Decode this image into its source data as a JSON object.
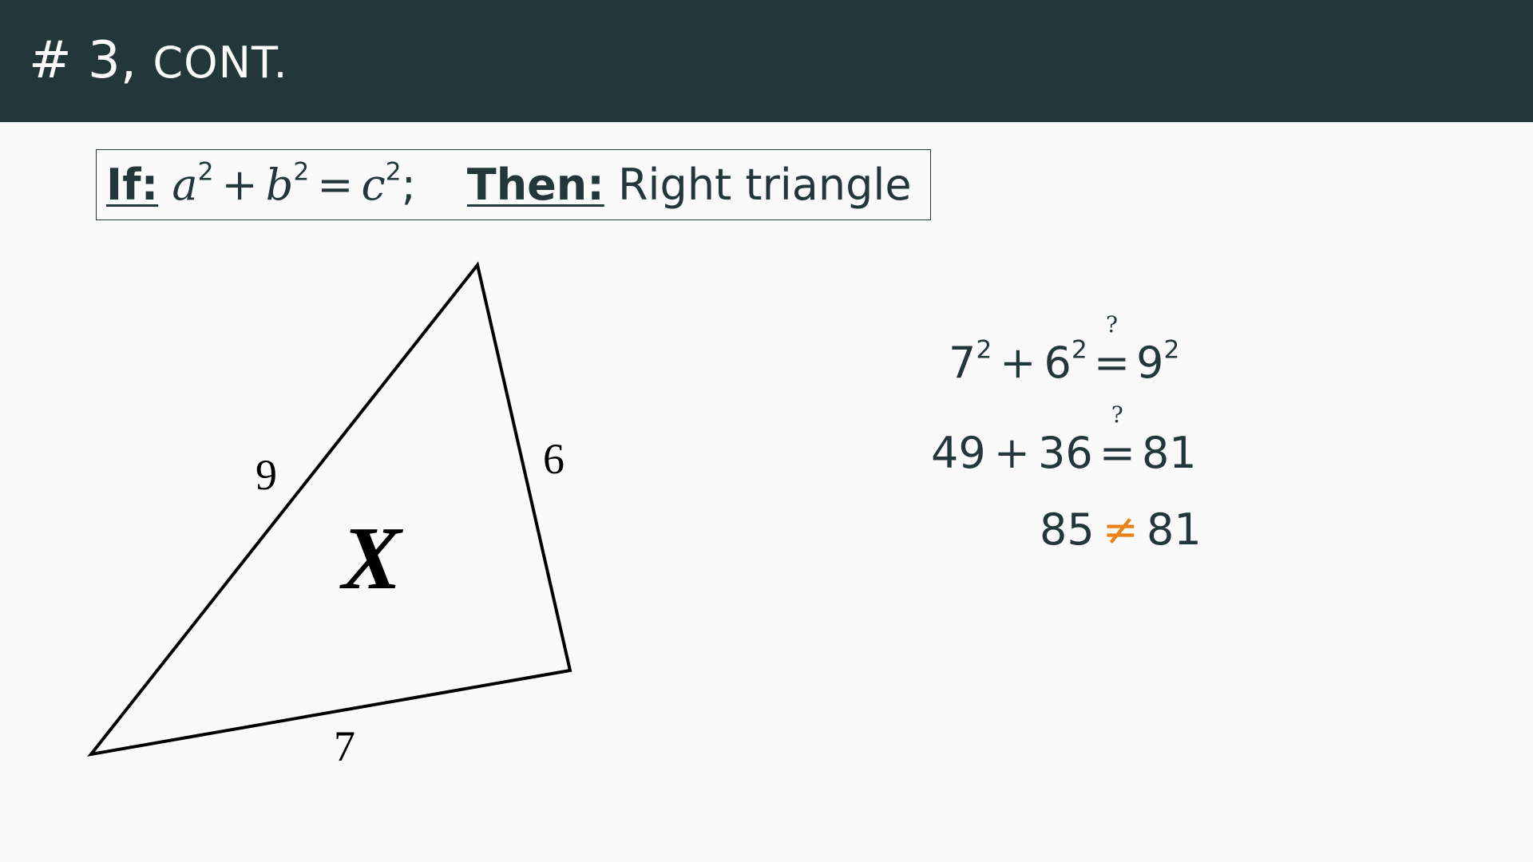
{
  "header": {
    "number": "# 3,",
    "title": "cont."
  },
  "rule": {
    "if_label": "If:",
    "a": "a",
    "b": "b",
    "c": "c",
    "exp": "2",
    "plus": "+",
    "equals": "=",
    "semicolon": ";",
    "then_label": "Then:",
    "then_text": "Right triangle"
  },
  "triangle": {
    "side_a": "9",
    "side_b": "6",
    "side_c": "7",
    "center_mark": "X"
  },
  "equations": {
    "line1": {
      "t1": "7",
      "t2": "6",
      "rhs": "9",
      "exp": "2",
      "plus": "+",
      "qmark": "?",
      "eq": "="
    },
    "line2": {
      "t1": "49",
      "t2": "36",
      "rhs": "81",
      "plus": "+",
      "qmark": "?",
      "eq": "="
    },
    "line3": {
      "lhs": "85",
      "neq": "≠",
      "rhs": "81"
    }
  },
  "colors": {
    "header_bg": "#23373b",
    "page_bg": "#fafafa",
    "accent": "#eb811b"
  }
}
